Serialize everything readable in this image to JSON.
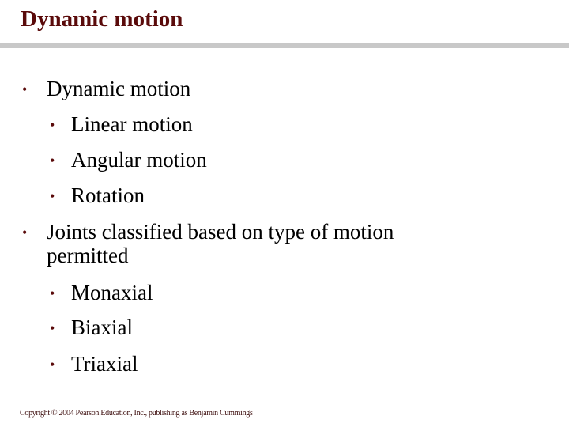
{
  "slide": {
    "title": "Dynamic motion",
    "bullets": [
      {
        "text": "Dynamic motion",
        "level": 1
      },
      {
        "text": "Linear motion",
        "level": 2
      },
      {
        "text": "Angular motion",
        "level": 2
      },
      {
        "text": "Rotation",
        "level": 2
      },
      {
        "text": "Joints classified based on type of motion",
        "level": 1
      },
      {
        "text": "permitted",
        "level": 1,
        "continuation": true
      },
      {
        "text": "Monaxial",
        "level": 2
      },
      {
        "text": "Biaxial",
        "level": 2
      },
      {
        "text": "Triaxial",
        "level": 2
      }
    ],
    "bullet_glyph": "•",
    "footer": "Copyright © 2004 Pearson Education, Inc., publishing as Benjamin Cummings",
    "colors": {
      "title": "#5a0a0a",
      "bullet": "#5a0a0a",
      "rule": "#c8c8c8"
    }
  }
}
